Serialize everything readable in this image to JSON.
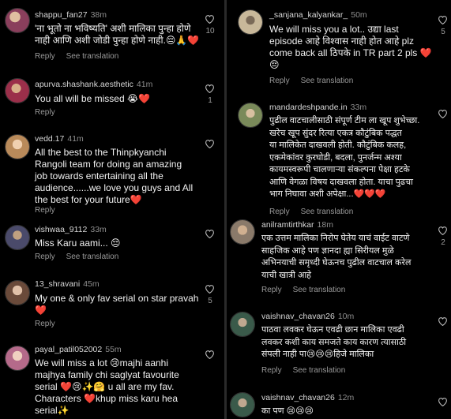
{
  "left_comments": [
    {
      "username": "shappu_fan27",
      "time": "38m",
      "text": "'ना भूतो ना भविष्यति' अशी मालिका पुन्हा होणे\nनाही आणि अशी जोडी पुन्हा होणे नाही.😔🙏❤️",
      "reply": "Reply",
      "translate": "See translation",
      "likes": "10",
      "avatar_color": "#8a3f5c"
    },
    {
      "username": "apurva.shashank.aesthetic",
      "time": "41m",
      "text": "You all will be missed 😭❤️",
      "reply": "Reply",
      "translate": "",
      "likes": "1",
      "avatar_color": "#9b2f4a"
    },
    {
      "username": "vedd.17",
      "time": "41m",
      "text": "All the best to the Thinpkyanchi\nRangoli team for doing an amazing\njob towards entertaining all the\naudience......we love you guys and All\nthe best for your future❤️",
      "reply": "Reply",
      "translate": "",
      "likes": "",
      "avatar_color": "#b98a5a"
    },
    {
      "username": "vishwaa_9112",
      "time": "33m",
      "text": "Miss Karu aami... 😔",
      "reply": "Reply",
      "translate": "See translation",
      "likes": "",
      "avatar_color": "#4a4a6a"
    },
    {
      "username": "13_shravani",
      "time": "45m",
      "text": "My one & only fav serial on star pravah\n❤️",
      "reply": "Reply",
      "translate": "",
      "likes": "5",
      "avatar_color": "#6a4a3a"
    },
    {
      "username": "payal_patil052002",
      "time": "55m",
      "text": "We will miss a lot 😢majhi aanhi\nmajhya family chi saglyat favourite\nserial ❤️😢✨🤗 u all are my fav.\nCharacters ❤️khup miss karu hea\nserial✨",
      "reply": "",
      "translate": "",
      "likes": "",
      "avatar_color": "#b56a8a"
    }
  ],
  "right_comments": [
    {
      "username": "_sanjana_kalyankar_",
      "time": "50m",
      "text": "We will miss you a lot.. उद्या last\nepisode आहे विश्वास नाही होत आहे plz\ncome back all ठिपके in TR part 2 pls ❤️\n😔",
      "reply": "Reply",
      "translate": "See translation",
      "likes": "5",
      "avatar_color": "#c8b89a"
    },
    {
      "username": "mandardeshpande.in",
      "time": "33m",
      "text": "पुढील वाटचालीसाठी संपूर्ण टीम ला  खूप शुभेच्छा.\nखरेच खूप सुंदर रित्या एकत्र कौटुंबिक पद्धत\nया मालिकेत दाखवली होती. कौटुंबिक कलह,\nएकमेकांवर कुरघोडी, बदला, पुनर्जन्म अश्या\nकायमस्वरूपी चालणाऱ्या संकल्पना पेक्षा हटके\nआणि वेगळा विषय दाखवला होता. याचा पुढचा\nभाग निघावा अशी अपेक्षा...❤️❤️❤️",
      "reply": "Reply",
      "translate": "See translation",
      "likes": "",
      "avatar_color": "#7a8a5a"
    },
    {
      "username": "anilramtirthkar",
      "time": "18m",
      "text": "एक उत्तम मालिका निरोप घेतेय याचं वाईट वाटणे\nसाहजिक आहे पण ज्ञानदा ह्या सिरीयल मुळे\nअभिनयाची समृध्दी घेऊनच पुढील वाटचाल करेल\nयाची खात्री आहे",
      "reply": "Reply",
      "translate": "See translation",
      "likes": "2",
      "avatar_color": "#8a7a6a"
    },
    {
      "username": "vaishnav_chavan26",
      "time": "10m",
      "text": "पाठवा लवकर घेऊन एवढी छान मालिका एवढी\nलवकर कशी काय समजते काय कारण त्यासाठी\nसंपली नाही पा😢😢😢हिजे मालिका",
      "reply": "Reply",
      "translate": "See translation",
      "likes": "",
      "avatar_color": "#3a5a4a"
    },
    {
      "username": "vaishnav_chavan26",
      "time": "12m",
      "text": "का पण 😢😢😢",
      "reply": "",
      "translate": "",
      "likes": "",
      "avatar_color": "#3a5a4a"
    }
  ]
}
